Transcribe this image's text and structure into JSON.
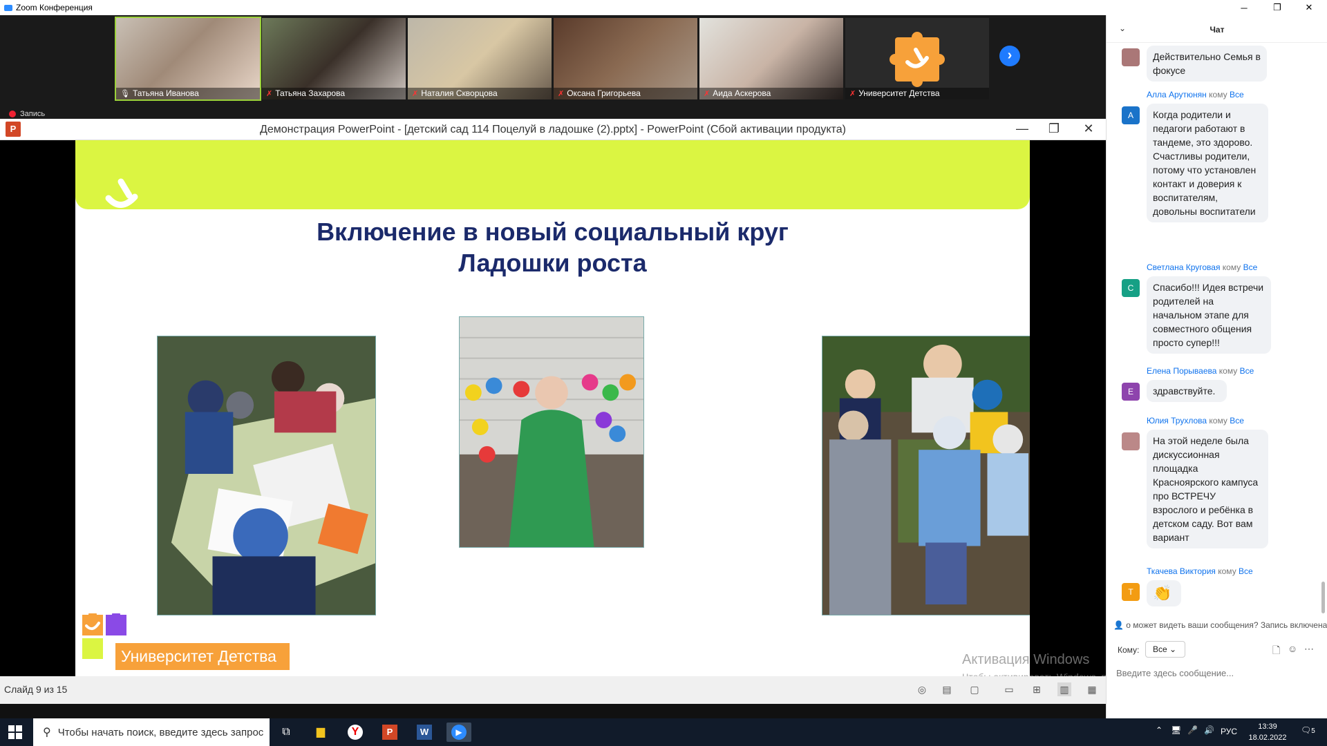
{
  "window": {
    "title": "Zoom Конференция",
    "minimize": "─",
    "restore": "❐",
    "close": "✕"
  },
  "gallery": {
    "participants": [
      {
        "name": "Татьяна Иванова",
        "muted": false
      },
      {
        "name": "Татьяна Захарова",
        "muted": true
      },
      {
        "name": "Наталия Скворцова",
        "muted": true
      },
      {
        "name": "Оксана Григорьева",
        "muted": true
      },
      {
        "name": "Аида Аскерова",
        "muted": true
      },
      {
        "name": "Университет Детства",
        "muted": true
      }
    ],
    "recording_label": "Запись"
  },
  "powerpoint": {
    "title": "Демонстрация PowerPoint - [детский сад 114 Поцелуй в ладошке (2).pptx] - PowerPoint (Сбой активации продукта)",
    "slide": {
      "title_line1": "Включение в новый социальный круг",
      "title_line2": "Ладошки роста",
      "logo_text": "Университет Детства"
    },
    "status": "Слайд 9 из 15"
  },
  "activation": {
    "line1": "Активация Windows",
    "line2": "Чтобы активировать Windows, перейдите в раздел \"Параметры\"."
  },
  "chat": {
    "title": "Чат",
    "messages": [
      {
        "text": "Действительно Семья в фокусе"
      },
      {
        "sender": "Алла Арутюнян",
        "to_prefix": "кому",
        "to": "Все",
        "initial": "А",
        "color": "#1a73c9",
        "text": "Когда родители и педагоги работают в тандеме, это здорово. Счастливы родители, потому что установлен контакт и доверия к воспитателям, довольны воспитатели"
      },
      {
        "sender": "Светлана Круговая",
        "to_prefix": "кому",
        "to": "Все",
        "initial": "С",
        "color": "#16a085",
        "text": "Спасибо!!! Идея встречи родителей на начальном этапе для совместного общения просто супер!!!"
      },
      {
        "sender": "Елена Порываева",
        "to_prefix": "кому",
        "to": "Все",
        "initial": "Е",
        "color": "#8e44ad",
        "text": "здравствуйте."
      },
      {
        "sender": "Юлия Трухлова",
        "to_prefix": "кому",
        "to": "Все",
        "initial": "",
        "text": "На этой неделе была дискуссионная площадка Красноярского кампуса про ВСТРЕЧУ взрослого и ребёнка в детском саду. Вот вам вариант"
      },
      {
        "sender": "Ткачева Виктория",
        "to_prefix": "кому",
        "to": "Все",
        "initial": "Т",
        "color": "#f39c12",
        "text": "👏"
      }
    ],
    "notice": "о может видеть ваши сообщения? Запись включена",
    "to_label": "Кому:",
    "to_value": "Все",
    "input_placeholder": "Введите здесь сообщение..."
  },
  "taskbar": {
    "search_placeholder": "Чтобы начать поиск, введите здесь запрос",
    "lang": "РУС",
    "time": "13:39",
    "date": "18.02.2022",
    "notifications": "5"
  }
}
